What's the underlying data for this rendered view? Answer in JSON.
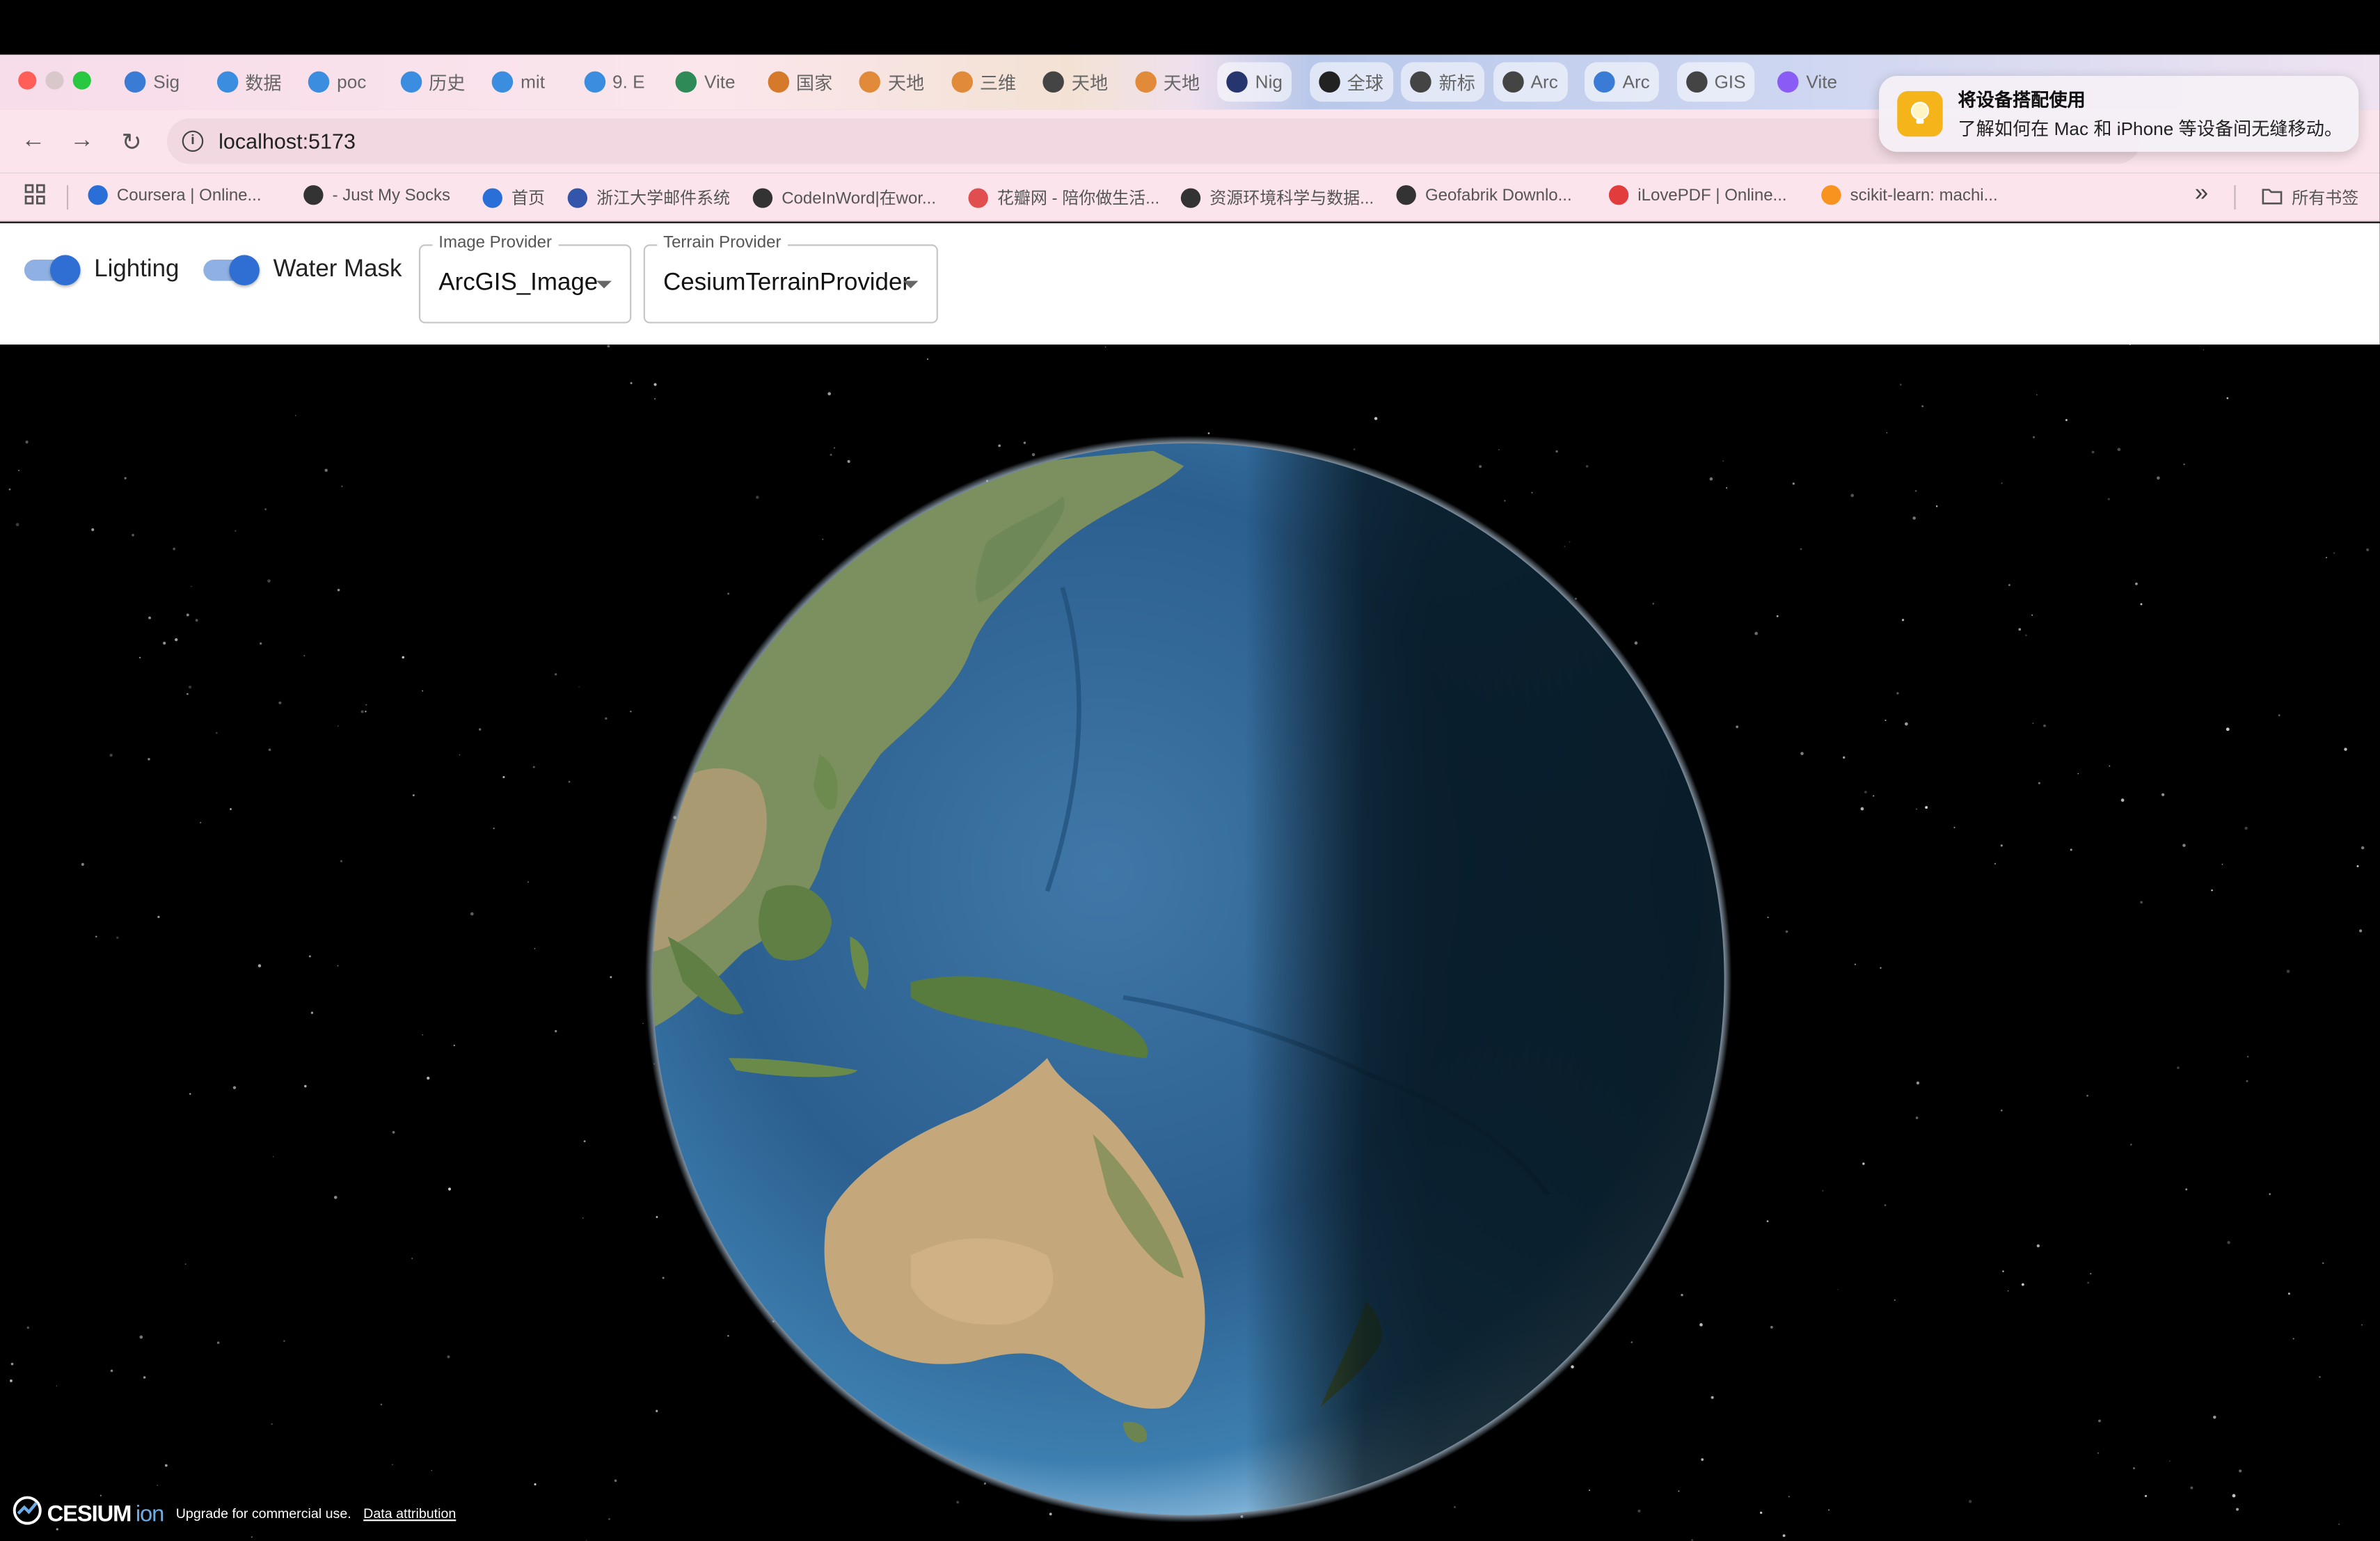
{
  "browser": {
    "tabs": [
      {
        "label": "Sig",
        "color": "#3a7bd5"
      },
      {
        "label": "数据",
        "color": "#3b8de0"
      },
      {
        "label": "poc",
        "color": "#3b8de0"
      },
      {
        "label": "历史",
        "color": "#3b8de0"
      },
      {
        "label": "mit",
        "color": "#3b8de0"
      },
      {
        "label": "9. E",
        "color": "#3b8de0"
      },
      {
        "label": "Vite",
        "color": "#2e8b57"
      },
      {
        "label": "国家",
        "color": "#d47a2a"
      },
      {
        "label": "天地",
        "color": "#e08a3a"
      },
      {
        "label": "三维",
        "color": "#e08a3a"
      },
      {
        "label": "天地",
        "color": "#444444"
      },
      {
        "label": "天地",
        "color": "#e08a3a"
      },
      {
        "label": "Nig",
        "color": "#26356e"
      },
      {
        "label": "全球",
        "color": "#222222"
      },
      {
        "label": "新标",
        "color": "#444444"
      },
      {
        "label": "Arc",
        "color": "#444444"
      },
      {
        "label": "Arc",
        "color": "#3a7bd5"
      },
      {
        "label": "GIS",
        "color": "#444444"
      },
      {
        "label": "Vite",
        "color": "#8a5cf5"
      }
    ],
    "url": "localhost:5173",
    "bookmarks": [
      {
        "label": "Coursera | Online...",
        "color": "#2a6fd8"
      },
      {
        "label": "- Just My Socks",
        "color": "#333333"
      },
      {
        "label": "首页",
        "color": "#2a6fd8"
      },
      {
        "label": "浙江大学邮件系统",
        "color": "#3355aa"
      },
      {
        "label": "CodeInWord|在wor...",
        "color": "#333333"
      },
      {
        "label": "花瓣网 - 陪你做生活...",
        "color": "#e04e50"
      },
      {
        "label": "资源环境科学与数据...",
        "color": "#333333"
      },
      {
        "label": "Geofabrik Downlo...",
        "color": "#333333"
      },
      {
        "label": "iLovePDF | Online...",
        "color": "#e23c3c"
      },
      {
        "label": "scikit-learn: machi...",
        "color": "#f7931e"
      }
    ],
    "all_bookmarks": "所有书签",
    "more_bookmarks": "»"
  },
  "notification": {
    "title": "将设备搭配使用",
    "body": "了解如何在 Mac 和 iPhone 等设备间无缝移动。"
  },
  "controls": {
    "lighting": {
      "label": "Lighting",
      "on": true
    },
    "water_mask": {
      "label": "Water Mask",
      "on": true
    },
    "image_provider": {
      "label": "Image Provider",
      "value": "ArcGIS_Image"
    },
    "terrain_provider": {
      "label": "Terrain Provider",
      "value": "CesiumTerrainProvider"
    }
  },
  "viewer": {
    "logo_text": "CESIUM",
    "logo_suffix": "ion",
    "upgrade_text": "Upgrade for commercial use.",
    "attribution_link": "Data attribution"
  }
}
